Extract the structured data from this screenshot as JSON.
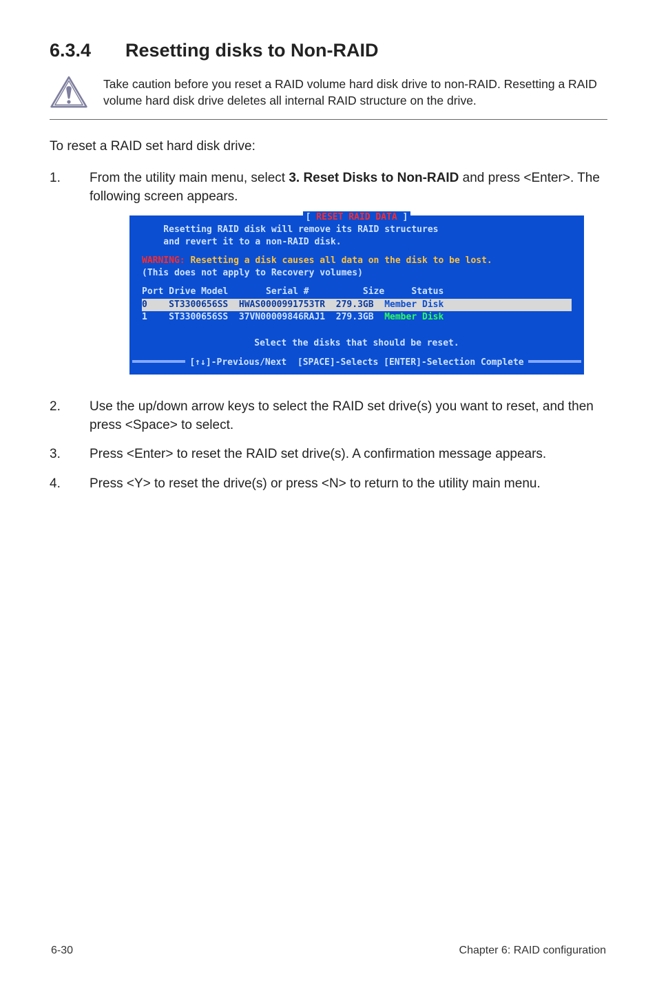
{
  "section": {
    "number": "6.3.4",
    "title": "Resetting disks to Non-RAID"
  },
  "caution": {
    "text": "Take caution before you reset a RAID volume hard disk drive to non-RAID. Resetting a RAID volume hard disk drive deletes all internal RAID structure on the drive."
  },
  "lead": "To reset a RAID set hard disk drive:",
  "steps": [
    {
      "num": "1.",
      "pre": "From the utility main menu, select ",
      "bold": "3. Reset Disks to Non-RAID",
      "post": " and press <Enter>. The following screen appears."
    },
    {
      "num": "2.",
      "text": "Use the up/down arrow keys to select the RAID set drive(s) you want to reset, and then press <Space> to select."
    },
    {
      "num": "3.",
      "text": "Press <Enter> to reset the RAID set drive(s). A confirmation message appears."
    },
    {
      "num": "4.",
      "text": "Press <Y> to reset the drive(s) or press <N> to return to the utility main menu."
    }
  ],
  "terminal": {
    "title": " RESET RAID DATA ",
    "lines": {
      "l1": "    Resetting RAID disk will remove its RAID structures",
      "l2": "    and revert it to a non-RAID disk."
    },
    "warning": {
      "label": "WARNING: ",
      "rest": "Resetting a disk causes all data on the disk to be lost."
    },
    "recovery_note": "(This does not apply to Recovery volumes)",
    "header": "Port Drive Model       Serial #          Size     Status",
    "rows": [
      {
        "left": "0    ST3300656SS  HWAS0000991753TR  279.3GB  ",
        "status": "Member Disk",
        "selected": true
      },
      {
        "left": "1    ST3300656SS  37VN00009846RAJ1  279.3GB  ",
        "status": "Member Disk",
        "selected": false
      }
    ],
    "prompt": "Select the disks that should be reset.",
    "footer": "[↑↓]-Previous/Next  [SPACE]-Selects [ENTER]-Selection Complete"
  },
  "footer": {
    "left": "6-30",
    "right": "Chapter 6: RAID configuration"
  }
}
